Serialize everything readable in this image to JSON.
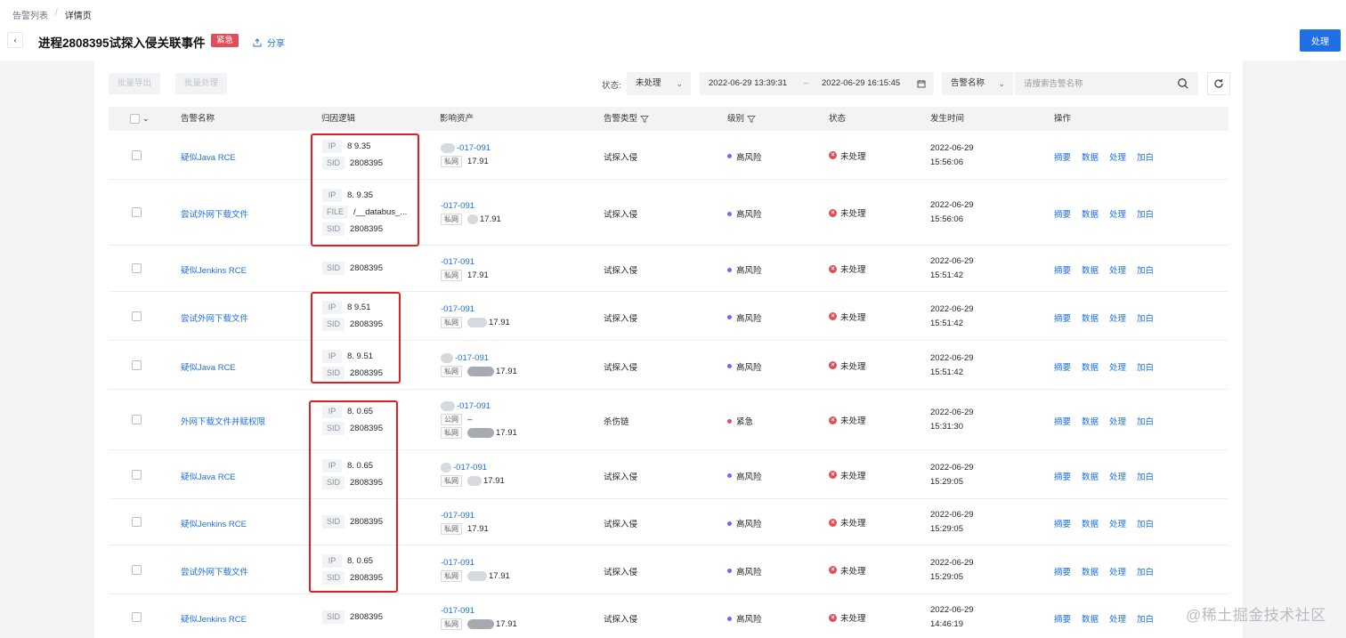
{
  "breadcrumb": {
    "parent": "告警列表",
    "separator": "/",
    "current": "详情页"
  },
  "header": {
    "back_label": "‹",
    "title": "进程2808395试探入侵关联事件",
    "badge": "紧急",
    "share_label": "分享",
    "action_label": "处理"
  },
  "toolbar": {
    "batch_export": "批量导出",
    "batch_handle": "批量处理",
    "status_label": "状态:",
    "status_value": "未处理",
    "date_start": "2022-06-29 13:39:31",
    "date_sep": "–",
    "date_end": "2022-06-29 16:15:45",
    "search_field": "告警名称",
    "search_placeholder": "请搜索告警名称"
  },
  "table": {
    "headers": {
      "name": "告警名称",
      "logic": "归因逻辑",
      "asset": "影响资产",
      "type": "告警类型",
      "level": "级别",
      "status": "状态",
      "time": "发生时间",
      "ops": "操作"
    },
    "ops_labels": [
      "摘要",
      "数据",
      "处理",
      "加白"
    ],
    "rows": [
      {
        "name": "疑似Java RCE",
        "attrs": [
          {
            "k": "IP",
            "v": "8       9.35"
          },
          {
            "k": "SID",
            "v": "2808395"
          }
        ],
        "asset_name": "-017-091",
        "asset_tags": [
          {
            "t": "私网",
            "v": "17.91"
          }
        ],
        "type": "试探入侵",
        "level": "高风险",
        "level_color": "#7b61ff",
        "status": "未处理",
        "date": "2022-06-29",
        "clock": "15:56:06"
      },
      {
        "name": "尝试外网下载文件",
        "attrs": [
          {
            "k": "IP",
            "v": "8.      9.35"
          },
          {
            "k": "FILE",
            "v": "/__databus_..."
          },
          {
            "k": "SID",
            "v": "2808395"
          }
        ],
        "asset_name": "-017-091",
        "asset_tags": [
          {
            "t": "私网",
            "v": "17.91"
          }
        ],
        "type": "试探入侵",
        "level": "高风险",
        "level_color": "#7b61ff",
        "status": "未处理",
        "date": "2022-06-29",
        "clock": "15:56:06"
      },
      {
        "name": "疑似Jenkins RCE",
        "attrs": [
          {
            "k": "SID",
            "v": "2808395"
          }
        ],
        "asset_name": "-017-091",
        "asset_tags": [
          {
            "t": "私网",
            "v": "17.91"
          }
        ],
        "type": "试探入侵",
        "level": "高风险",
        "level_color": "#7b61ff",
        "status": "未处理",
        "date": "2022-06-29",
        "clock": "15:51:42"
      },
      {
        "name": "尝试外网下载文件",
        "attrs": [
          {
            "k": "IP",
            "v": "8          9.51"
          },
          {
            "k": "SID",
            "v": "2808395"
          }
        ],
        "asset_name": "-017-091",
        "asset_tags": [
          {
            "t": "私网",
            "v": "17.91"
          }
        ],
        "type": "试探入侵",
        "level": "高风险",
        "level_color": "#7b61ff",
        "status": "未处理",
        "date": "2022-06-29",
        "clock": "15:51:42"
      },
      {
        "name": "疑似Java RCE",
        "attrs": [
          {
            "k": "IP",
            "v": "8.        9.51"
          },
          {
            "k": "SID",
            "v": "2808395"
          }
        ],
        "asset_name": "-017-091",
        "asset_tags": [
          {
            "t": "私网",
            "v": "17.91"
          }
        ],
        "type": "试探入侵",
        "level": "高风险",
        "level_color": "#7b61ff",
        "status": "未处理",
        "date": "2022-06-29",
        "clock": "15:51:42"
      },
      {
        "name": "外网下载文件并赋权限",
        "attrs": [
          {
            "k": "IP",
            "v": "8.        0.65"
          },
          {
            "k": "SID",
            "v": "2808395"
          }
        ],
        "asset_name": "-017-091",
        "asset_tags": [
          {
            "t": "公网",
            "v": "–"
          },
          {
            "t": "私网",
            "v": "17.91"
          }
        ],
        "type": "杀伤链",
        "level": "紧急",
        "level_color": "#e34d59",
        "status": "未处理",
        "date": "2022-06-29",
        "clock": "15:31:30"
      },
      {
        "name": "疑似Java RCE",
        "attrs": [
          {
            "k": "IP",
            "v": "8.      0.65"
          },
          {
            "k": "SID",
            "v": "2808395"
          }
        ],
        "asset_name": "-017-091",
        "asset_tags": [
          {
            "t": "私网",
            "v": "17.91"
          }
        ],
        "type": "试探入侵",
        "level": "高风险",
        "level_color": "#7b61ff",
        "status": "未处理",
        "date": "2022-06-29",
        "clock": "15:29:05"
      },
      {
        "name": "疑似Jenkins RCE",
        "attrs": [
          {
            "k": "SID",
            "v": "2808395"
          }
        ],
        "asset_name": "-017-091",
        "asset_tags": [
          {
            "t": "私网",
            "v": "17.91"
          }
        ],
        "type": "试探入侵",
        "level": "高风险",
        "level_color": "#7b61ff",
        "status": "未处理",
        "date": "2022-06-29",
        "clock": "15:29:05"
      },
      {
        "name": "尝试外网下载文件",
        "attrs": [
          {
            "k": "IP",
            "v": "8.      0.65"
          },
          {
            "k": "SID",
            "v": "2808395"
          }
        ],
        "asset_name": "-017-091",
        "asset_tags": [
          {
            "t": "私网",
            "v": "17.91"
          }
        ],
        "type": "试探入侵",
        "level": "高风险",
        "level_color": "#7b61ff",
        "status": "未处理",
        "date": "2022-06-29",
        "clock": "15:29:05"
      },
      {
        "name": "疑似Jenkins RCE",
        "attrs": [
          {
            "k": "SID",
            "v": "2808395"
          }
        ],
        "asset_name": "-017-091",
        "asset_tags": [
          {
            "t": "私网",
            "v": "17.91"
          }
        ],
        "type": "试探入侵",
        "level": "高风险",
        "level_color": "#7b61ff",
        "status": "未处理",
        "date": "2022-06-29",
        "clock": "14:46:19"
      }
    ]
  },
  "watermark": "@稀土掘金技术社区",
  "colors": {
    "primary": "#1f6fe5",
    "danger": "#e34d59",
    "high_risk": "#7b61ff",
    "highlight_box": "#e02020"
  }
}
